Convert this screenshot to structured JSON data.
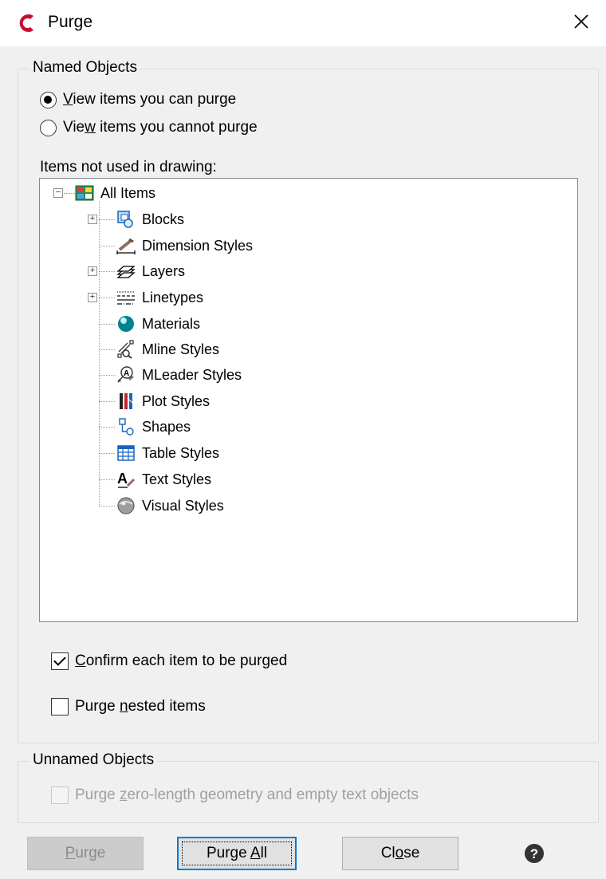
{
  "window": {
    "title": "Purge",
    "close_icon": "close-icon",
    "app_icon": "app-logo-icon"
  },
  "named_objects": {
    "legend": "Named Objects",
    "radio_can": {
      "pre": "",
      "u": "V",
      "post": "iew items you can purge",
      "checked": true
    },
    "radio_cannot": {
      "pre": "Vie",
      "u": "w",
      "post": " items you cannot purge",
      "checked": false
    },
    "tree_label": "Items not used in drawing:",
    "tree": {
      "root": {
        "label": "All Items",
        "icon": "all-items-icon",
        "expanded": true
      },
      "items": [
        {
          "label": "Blocks",
          "icon": "blocks-icon",
          "expandable": true
        },
        {
          "label": "Dimension Styles",
          "icon": "dimension-styles-icon",
          "expandable": false
        },
        {
          "label": "Layers",
          "icon": "layers-icon",
          "expandable": true
        },
        {
          "label": "Linetypes",
          "icon": "linetypes-icon",
          "expandable": true
        },
        {
          "label": "Materials",
          "icon": "materials-icon",
          "expandable": false
        },
        {
          "label": "Mline Styles",
          "icon": "mline-styles-icon",
          "expandable": false
        },
        {
          "label": "MLeader Styles",
          "icon": "mleader-styles-icon",
          "expandable": false
        },
        {
          "label": "Plot Styles",
          "icon": "plot-styles-icon",
          "expandable": false
        },
        {
          "label": "Shapes",
          "icon": "shapes-icon",
          "expandable": false
        },
        {
          "label": "Table Styles",
          "icon": "table-styles-icon",
          "expandable": false
        },
        {
          "label": "Text Styles",
          "icon": "text-styles-icon",
          "expandable": false
        },
        {
          "label": "Visual Styles",
          "icon": "visual-styles-icon",
          "expandable": false
        }
      ]
    },
    "confirm": {
      "pre": "",
      "u": "C",
      "post": "onfirm each item to be purged",
      "checked": true
    },
    "nested": {
      "pre": "Purge ",
      "u": "n",
      "post": "ested items",
      "checked": false
    }
  },
  "unnamed_objects": {
    "legend": "Unnamed Objects",
    "zero_length": {
      "pre": "Purge ",
      "u": "z",
      "post": "ero-length geometry and empty text objects",
      "checked": false,
      "enabled": false
    }
  },
  "buttons": {
    "purge": {
      "pre": "",
      "u": "P",
      "post": "urge",
      "enabled": false
    },
    "purge_all": {
      "pre": "Purge ",
      "u": "A",
      "post": "ll",
      "default": true
    },
    "close": {
      "pre": "Cl",
      "u": "o",
      "post": "se"
    }
  },
  "help_icon": "help-icon",
  "colors": {
    "accent": "#0078d7",
    "app_logo": "#c8102e"
  }
}
